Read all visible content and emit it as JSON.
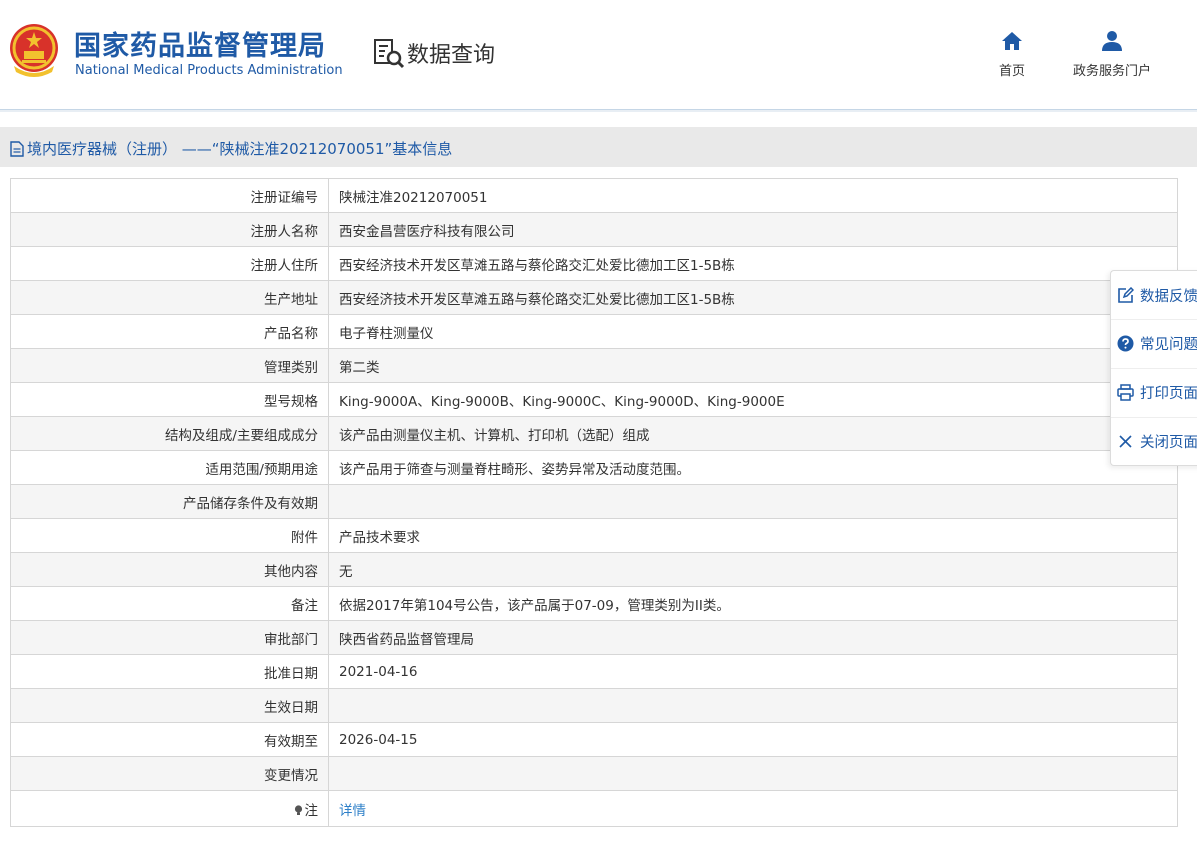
{
  "header": {
    "org_name_cn": "国家药品监督管理局",
    "org_name_en": "National Medical Products Administration",
    "app_label": "数据查询",
    "nav": [
      {
        "label": "首页",
        "icon": "home-icon"
      },
      {
        "label": "政务服务门户",
        "icon": "user-icon"
      }
    ]
  },
  "section": {
    "title": "境内医疗器械（注册） ——“陕械注准20212070051”基本信息",
    "icon": "document-icon"
  },
  "record": {
    "rows": [
      {
        "label": "注册证编号",
        "value": "陕械注准20212070051"
      },
      {
        "label": "注册人名称",
        "value": "西安金昌营医疗科技有限公司"
      },
      {
        "label": "注册人住所",
        "value": "西安经济技术开发区草滩五路与蔡伦路交汇处爱比德加工区1-5B栋"
      },
      {
        "label": "生产地址",
        "value": "西安经济技术开发区草滩五路与蔡伦路交汇处爱比德加工区1-5B栋"
      },
      {
        "label": "产品名称",
        "value": "电子脊柱测量仪"
      },
      {
        "label": "管理类别",
        "value": "第二类"
      },
      {
        "label": "型号规格",
        "value": "King-9000A、King-9000B、King-9000C、King-9000D、King-9000E"
      },
      {
        "label": "结构及组成/主要组成成分",
        "value": "该产品由测量仪主机、计算机、打印机（选配）组成"
      },
      {
        "label": "适用范围/预期用途",
        "value": "该产品用于筛查与测量脊柱畸形、姿势异常及活动度范围。"
      },
      {
        "label": "产品储存条件及有效期",
        "value": ""
      },
      {
        "label": "附件",
        "value": "产品技术要求"
      },
      {
        "label": "其他内容",
        "value": "无"
      },
      {
        "label": "备注",
        "value": "依据2017年第104号公告，该产品属于07-09，管理类别为II类。"
      },
      {
        "label": "审批部门",
        "value": "陕西省药品监督管理局"
      },
      {
        "label": "批准日期",
        "value": "2021-04-16"
      },
      {
        "label": "生效日期",
        "value": ""
      },
      {
        "label": "有效期至",
        "value": "2026-04-15"
      },
      {
        "label": "变更情况",
        "value": ""
      }
    ],
    "note": {
      "label": "注",
      "link": "详情",
      "icon": "lightbulb-icon"
    }
  },
  "side_panel": {
    "items": [
      {
        "label": "数据反馈",
        "icon": "edit-icon"
      },
      {
        "label": "常见问题",
        "icon": "help-icon"
      },
      {
        "label": "打印页面",
        "icon": "print-icon"
      },
      {
        "label": "关闭页面",
        "icon": "close-icon"
      }
    ]
  },
  "colors": {
    "brand_blue": "#1f5aa6",
    "link_blue": "#2d7fc8",
    "section_bg": "#e9e9e9",
    "row_alt_bg": "#f5f5f5",
    "border": "#d6d6d6"
  }
}
